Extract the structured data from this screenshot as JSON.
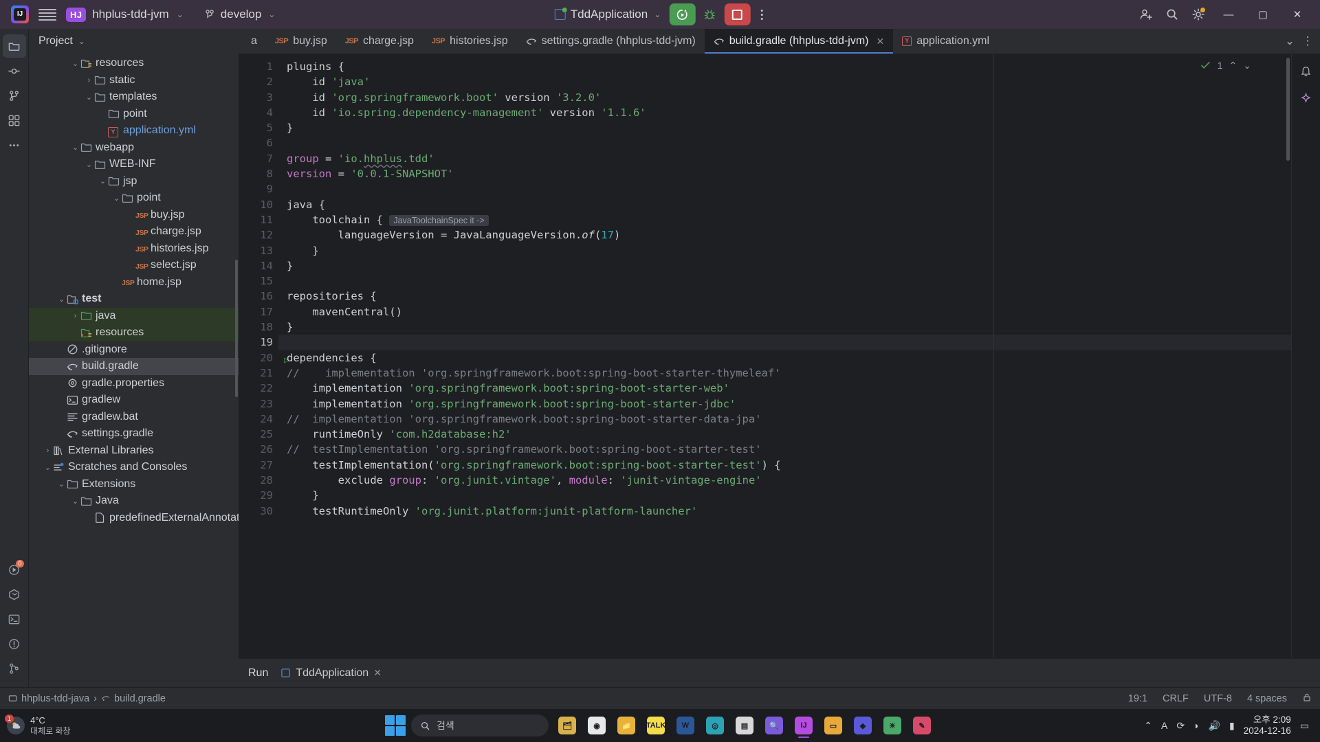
{
  "titlebar": {
    "logo_alt": "IJ",
    "project_badge": "HJ",
    "project_name": "hhplus-tdd-jvm",
    "branch": "develop",
    "run_config": "TddApplication",
    "chevron": "⌄"
  },
  "rail": {
    "items": [
      {
        "name": "project-tool-window",
        "icon": "folder-icon",
        "badge": ""
      },
      {
        "name": "commit-tool-window",
        "icon": "commit-icon",
        "badge": ""
      },
      {
        "name": "pull-requests-tool-window",
        "icon": "branch-icon",
        "badge": ""
      },
      {
        "name": "structure-tool-window",
        "icon": "grid-icon",
        "badge": ""
      },
      {
        "name": "more-tool-windows",
        "icon": "ellipsis-icon",
        "badge": ""
      }
    ],
    "bottom": [
      {
        "name": "run-tool-window",
        "icon": "run-icon",
        "badge": "0"
      },
      {
        "name": "services-tool-window",
        "icon": "services-icon",
        "badge": ""
      },
      {
        "name": "terminal-tool-window",
        "icon": "terminal-icon",
        "badge": ""
      },
      {
        "name": "problems-tool-window",
        "icon": "warning-icon",
        "badge": ""
      },
      {
        "name": "git-tool-window",
        "icon": "git-icon",
        "badge": ""
      }
    ]
  },
  "project_panel": {
    "title": "Project",
    "tree": [
      {
        "indent": 3,
        "arrow": "⌄",
        "icon": "folder-resources",
        "label": "resources",
        "state": "normal"
      },
      {
        "indent": 4,
        "arrow": "›",
        "icon": "folder",
        "label": "static",
        "state": "normal"
      },
      {
        "indent": 4,
        "arrow": "⌄",
        "icon": "folder",
        "label": "templates",
        "state": "normal"
      },
      {
        "indent": 5,
        "arrow": "",
        "icon": "folder",
        "label": "point",
        "state": "normal"
      },
      {
        "indent": 5,
        "arrow": "",
        "icon": "yml",
        "label": "application.yml",
        "state": "blue"
      },
      {
        "indent": 3,
        "arrow": "⌄",
        "icon": "folder",
        "label": "webapp",
        "state": "normal"
      },
      {
        "indent": 4,
        "arrow": "⌄",
        "icon": "folder",
        "label": "WEB-INF",
        "state": "normal"
      },
      {
        "indent": 5,
        "arrow": "⌄",
        "icon": "folder",
        "label": "jsp",
        "state": "normal"
      },
      {
        "indent": 6,
        "arrow": "⌄",
        "icon": "folder",
        "label": "point",
        "state": "normal"
      },
      {
        "indent": 7,
        "arrow": "",
        "icon": "jsp",
        "label": "buy.jsp",
        "state": "normal"
      },
      {
        "indent": 7,
        "arrow": "",
        "icon": "jsp",
        "label": "charge.jsp",
        "state": "normal"
      },
      {
        "indent": 7,
        "arrow": "",
        "icon": "jsp",
        "label": "histories.jsp",
        "state": "normal"
      },
      {
        "indent": 7,
        "arrow": "",
        "icon": "jsp",
        "label": "select.jsp",
        "state": "normal"
      },
      {
        "indent": 6,
        "arrow": "",
        "icon": "jsp",
        "label": "home.jsp",
        "state": "normal"
      },
      {
        "indent": 2,
        "arrow": "⌄",
        "icon": "folder-test",
        "label": "test",
        "state": "bold"
      },
      {
        "indent": 3,
        "arrow": "›",
        "icon": "folder-green",
        "label": "java",
        "state": "source"
      },
      {
        "indent": 3,
        "arrow": "",
        "icon": "folder-green-res",
        "label": "resources",
        "state": "source"
      },
      {
        "indent": 2,
        "arrow": "",
        "icon": "gitignore",
        "label": ".gitignore",
        "state": "normal"
      },
      {
        "indent": 2,
        "arrow": "",
        "icon": "gradle",
        "label": "build.gradle",
        "state": "selected"
      },
      {
        "indent": 2,
        "arrow": "",
        "icon": "properties",
        "label": "gradle.properties",
        "state": "normal"
      },
      {
        "indent": 2,
        "arrow": "",
        "icon": "shell",
        "label": "gradlew",
        "state": "normal"
      },
      {
        "indent": 2,
        "arrow": "",
        "icon": "bat",
        "label": "gradlew.bat",
        "state": "normal"
      },
      {
        "indent": 2,
        "arrow": "",
        "icon": "gradle",
        "label": "settings.gradle",
        "state": "normal"
      },
      {
        "indent": 1,
        "arrow": "›",
        "icon": "library",
        "label": "External Libraries",
        "state": "normal"
      },
      {
        "indent": 1,
        "arrow": "⌄",
        "icon": "scratches",
        "label": "Scratches and Consoles",
        "state": "normal"
      },
      {
        "indent": 2,
        "arrow": "⌄",
        "icon": "folder",
        "label": "Extensions",
        "state": "normal"
      },
      {
        "indent": 3,
        "arrow": "⌄",
        "icon": "folder",
        "label": "Java",
        "state": "normal"
      },
      {
        "indent": 4,
        "arrow": "",
        "icon": "file",
        "label": "predefinedExternalAnnotations",
        "state": "normal"
      }
    ]
  },
  "editor_tabs": {
    "left_cut": "a",
    "tabs": [
      {
        "label": "buy.jsp",
        "icon": "jsp",
        "active": false,
        "closable": false
      },
      {
        "label": "charge.jsp",
        "icon": "jsp",
        "active": false,
        "closable": false
      },
      {
        "label": "histories.jsp",
        "icon": "jsp",
        "active": false,
        "closable": false
      },
      {
        "label": "settings.gradle (hhplus-tdd-jvm)",
        "icon": "gradle",
        "active": false,
        "closable": false
      },
      {
        "label": "build.gradle (hhplus-tdd-jvm)",
        "icon": "gradle",
        "active": true,
        "closable": true
      },
      {
        "label": "application.yml",
        "icon": "yml",
        "active": false,
        "closable": false
      }
    ],
    "right_buttons": [
      "⌄",
      "⋮"
    ]
  },
  "editor": {
    "inspection_count": "1",
    "badge_icons": [
      "check-icon",
      "chevron-up-icon",
      "chevron-down-icon"
    ],
    "lines": [
      {
        "n": 1,
        "runnable": false,
        "current": false,
        "tokens": [
          {
            "t": "plugins {",
            "c": "fn"
          }
        ]
      },
      {
        "n": 2,
        "runnable": false,
        "current": false,
        "tokens": [
          {
            "t": "    id ",
            "c": "fn"
          },
          {
            "t": "'java'",
            "c": "str"
          }
        ]
      },
      {
        "n": 3,
        "runnable": false,
        "current": false,
        "tokens": [
          {
            "t": "    id ",
            "c": "fn"
          },
          {
            "t": "'org.springframework.boot'",
            "c": "str"
          },
          {
            "t": " version ",
            "c": "fn"
          },
          {
            "t": "'3.2.0'",
            "c": "str"
          }
        ]
      },
      {
        "n": 4,
        "runnable": false,
        "current": false,
        "tokens": [
          {
            "t": "    id ",
            "c": "fn"
          },
          {
            "t": "'io.spring.dependency-management'",
            "c": "str"
          },
          {
            "t": " version ",
            "c": "fn"
          },
          {
            "t": "'1.1.6'",
            "c": "str"
          }
        ]
      },
      {
        "n": 5,
        "runnable": false,
        "current": false,
        "tokens": [
          {
            "t": "}",
            "c": "fn"
          }
        ]
      },
      {
        "n": 6,
        "runnable": false,
        "current": false,
        "tokens": []
      },
      {
        "n": 7,
        "runnable": false,
        "current": false,
        "tokens": [
          {
            "t": "group",
            "c": "kw"
          },
          {
            "t": " = ",
            "c": "fn"
          },
          {
            "t": "'io.",
            "c": "str"
          },
          {
            "t": "hhplus",
            "c": "str wav"
          },
          {
            "t": ".tdd'",
            "c": "str"
          }
        ]
      },
      {
        "n": 8,
        "runnable": false,
        "current": false,
        "tokens": [
          {
            "t": "version",
            "c": "kw"
          },
          {
            "t": " = ",
            "c": "fn"
          },
          {
            "t": "'0.0.1-SNAPSHOT'",
            "c": "str"
          }
        ]
      },
      {
        "n": 9,
        "runnable": false,
        "current": false,
        "tokens": []
      },
      {
        "n": 10,
        "runnable": false,
        "current": false,
        "tokens": [
          {
            "t": "java {",
            "c": "fn"
          }
        ]
      },
      {
        "n": 11,
        "runnable": false,
        "current": false,
        "tokens": [
          {
            "t": "    toolchain { ",
            "c": "fn"
          },
          {
            "t": "JavaToolchainSpec it ->",
            "c": "hint"
          }
        ]
      },
      {
        "n": 12,
        "runnable": false,
        "current": false,
        "tokens": [
          {
            "t": "        languageVersion = JavaLanguageVersion.",
            "c": "fn"
          },
          {
            "t": "of",
            "c": "it"
          },
          {
            "t": "(",
            "c": "fn"
          },
          {
            "t": "17",
            "c": "num"
          },
          {
            "t": ")",
            "c": "fn"
          }
        ]
      },
      {
        "n": 13,
        "runnable": false,
        "current": false,
        "tokens": [
          {
            "t": "    }",
            "c": "fn"
          }
        ]
      },
      {
        "n": 14,
        "runnable": false,
        "current": false,
        "tokens": [
          {
            "t": "}",
            "c": "fn"
          }
        ]
      },
      {
        "n": 15,
        "runnable": false,
        "current": false,
        "tokens": []
      },
      {
        "n": 16,
        "runnable": false,
        "current": false,
        "tokens": [
          {
            "t": "repositories {",
            "c": "fn"
          }
        ]
      },
      {
        "n": 17,
        "runnable": false,
        "current": false,
        "tokens": [
          {
            "t": "    mavenCentral()",
            "c": "fn"
          }
        ]
      },
      {
        "n": 18,
        "runnable": false,
        "current": false,
        "tokens": [
          {
            "t": "}",
            "c": "fn"
          }
        ]
      },
      {
        "n": 19,
        "runnable": false,
        "current": true,
        "tokens": []
      },
      {
        "n": 20,
        "runnable": true,
        "current": false,
        "tokens": [
          {
            "t": "dependencies {",
            "c": "fn"
          }
        ]
      },
      {
        "n": 21,
        "runnable": false,
        "current": false,
        "tokens": [
          {
            "t": "//    implementation 'org.springframework.boot:spring-boot-starter-thymeleaf'",
            "c": "cmt"
          }
        ]
      },
      {
        "n": 22,
        "runnable": false,
        "current": false,
        "tokens": [
          {
            "t": "    implementation ",
            "c": "fn"
          },
          {
            "t": "'org.springframework.boot:spring-boot-starter-web'",
            "c": "str"
          }
        ]
      },
      {
        "n": 23,
        "runnable": false,
        "current": false,
        "tokens": [
          {
            "t": "    implementation ",
            "c": "fn"
          },
          {
            "t": "'org.springframework.boot:spring-boot-starter-jdbc'",
            "c": "str"
          }
        ]
      },
      {
        "n": 24,
        "runnable": false,
        "current": false,
        "tokens": [
          {
            "t": "//  implementation 'org.springframework.boot:spring-boot-starter-data-jpa'",
            "c": "cmt"
          }
        ]
      },
      {
        "n": 25,
        "runnable": false,
        "current": false,
        "tokens": [
          {
            "t": "    runtimeOnly ",
            "c": "fn"
          },
          {
            "t": "'com.h2database:h2'",
            "c": "str"
          }
        ]
      },
      {
        "n": 26,
        "runnable": false,
        "current": false,
        "tokens": [
          {
            "t": "//  testImplementation 'org.springframework.boot:spring-boot-starter-test'",
            "c": "cmt"
          }
        ]
      },
      {
        "n": 27,
        "runnable": false,
        "current": false,
        "tokens": [
          {
            "t": "    testImplementation(",
            "c": "fn"
          },
          {
            "t": "'org.springframework.boot:spring-boot-starter-test'",
            "c": "str"
          },
          {
            "t": ") {",
            "c": "fn"
          }
        ]
      },
      {
        "n": 28,
        "runnable": false,
        "current": false,
        "tokens": [
          {
            "t": "        exclude ",
            "c": "fn"
          },
          {
            "t": "group",
            "c": "kw"
          },
          {
            "t": ": ",
            "c": "fn"
          },
          {
            "t": "'org.junit.vintage'",
            "c": "str"
          },
          {
            "t": ", ",
            "c": "fn"
          },
          {
            "t": "module",
            "c": "kw"
          },
          {
            "t": ": ",
            "c": "fn"
          },
          {
            "t": "'junit-vintage-engine'",
            "c": "str"
          }
        ]
      },
      {
        "n": 29,
        "runnable": false,
        "current": false,
        "tokens": [
          {
            "t": "    }",
            "c": "fn"
          }
        ]
      },
      {
        "n": 30,
        "runnable": false,
        "current": false,
        "tokens": [
          {
            "t": "    testRuntimeOnly ",
            "c": "fn"
          },
          {
            "t": "'org.junit.platform:junit-platform-launcher'",
            "c": "str"
          }
        ]
      }
    ]
  },
  "run_panel": {
    "title": "Run",
    "tab_label": "TddApplication",
    "close": "✕"
  },
  "status_bar": {
    "breadcrumb": [
      "hhplus-tdd-java",
      "build.gradle"
    ],
    "caret": "19:1",
    "line_sep": "CRLF",
    "encoding": "UTF-8",
    "indent": "4 spaces",
    "lock_icon": "lock-icon"
  },
  "taskbar": {
    "weather_temp": "4°C",
    "weather_desc": "대체로 화창",
    "weather_badge": "1",
    "search_placeholder": "검색",
    "apps": [
      {
        "name": "file-explorer-icon",
        "glyph": "🗂"
      },
      {
        "name": "chrome-icon",
        "glyph": "◉"
      },
      {
        "name": "folder-icon",
        "glyph": "📁"
      },
      {
        "name": "kakaotalk-icon",
        "glyph": "TALK"
      },
      {
        "name": "word-icon",
        "glyph": "W"
      },
      {
        "name": "edge-icon",
        "glyph": "◎"
      },
      {
        "name": "notes-icon",
        "glyph": "▤"
      },
      {
        "name": "search-app-icon",
        "glyph": "🔍"
      },
      {
        "name": "intellij-icon",
        "glyph": "IJ"
      },
      {
        "name": "sticky-notes-icon",
        "glyph": "▭"
      },
      {
        "name": "teams-icon",
        "glyph": "◆"
      },
      {
        "name": "slack-icon",
        "glyph": "✳"
      },
      {
        "name": "paint-icon",
        "glyph": "✎"
      }
    ],
    "clock_time": "오후 2:09",
    "clock_date": "2024-12-16"
  }
}
